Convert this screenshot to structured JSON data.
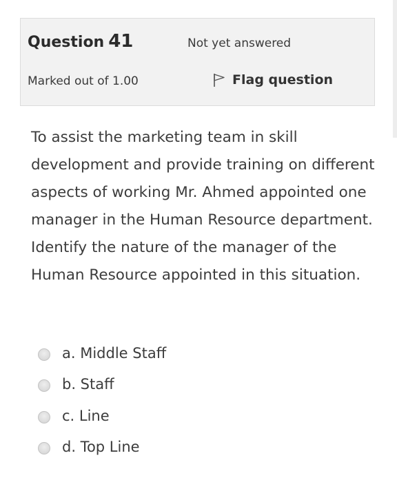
{
  "info": {
    "question_label": "Question",
    "question_number": "41",
    "state": "Not yet answered",
    "grade": "Marked out of 1.00",
    "flag_label": "Flag question",
    "flag_icon": "flag-icon"
  },
  "question": {
    "text": "To assist the marketing team in skill development and provide training on different aspects of working Mr. Ahmed appointed one manager in the Human Resource department. Identify the nature of the manager of the Human Resource appointed in this situation."
  },
  "answers": {
    "options": [
      {
        "label": "a. Middle Staff",
        "selected": false
      },
      {
        "label": "b. Staff",
        "selected": false
      },
      {
        "label": "c. Line",
        "selected": false
      },
      {
        "label": "d. Top Line",
        "selected": false
      }
    ]
  },
  "colors": {
    "info_background": "#f2f2f2",
    "info_border": "#dcdcdc",
    "text": "#333333"
  }
}
